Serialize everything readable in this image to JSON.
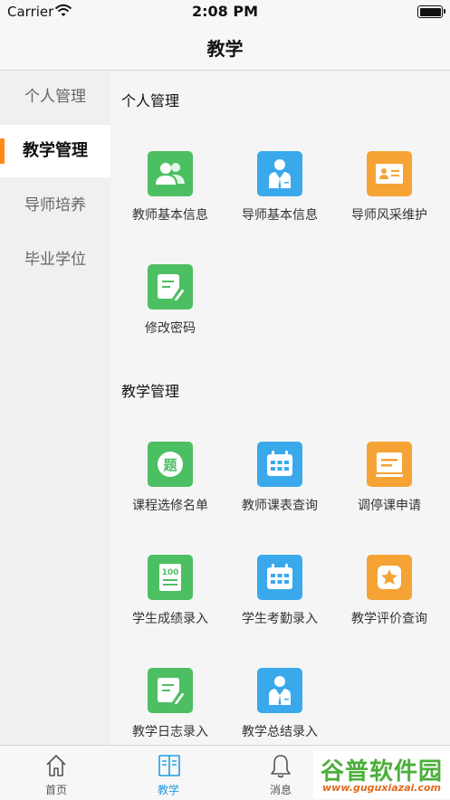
{
  "status": {
    "carrier": "Carrier",
    "time": "2:08 PM"
  },
  "nav": {
    "title": "教学"
  },
  "sidebar": {
    "items": [
      {
        "label": "个人管理",
        "active": false
      },
      {
        "label": "教学管理",
        "active": true
      },
      {
        "label": "导师培养",
        "active": false
      },
      {
        "label": "毕业学位",
        "active": false
      }
    ]
  },
  "sections": [
    {
      "title": "个人管理",
      "items": [
        {
          "label": "教师基本信息",
          "icon": "user-group-icon",
          "color": "#4cbf62"
        },
        {
          "label": "导师基本信息",
          "icon": "mentor-icon",
          "color": "#3aa9ec"
        },
        {
          "label": "导师风采维护",
          "icon": "id-card-icon",
          "color": "#f5a335"
        },
        {
          "label": "修改密码",
          "icon": "edit-document-icon",
          "color": "#4cbf62"
        }
      ]
    },
    {
      "title": "教学管理",
      "items": [
        {
          "label": "课程选修名单",
          "icon": "question-badge-icon",
          "color": "#4cbf62"
        },
        {
          "label": "教师课表查询",
          "icon": "calendar-icon",
          "color": "#3aa9ec"
        },
        {
          "label": "调停课申请",
          "icon": "board-icon",
          "color": "#f5a335"
        },
        {
          "label": "学生成绩录入",
          "icon": "score-sheet-icon",
          "color": "#4cbf62"
        },
        {
          "label": "学生考勤录入",
          "icon": "calendar-icon",
          "color": "#3aa9ec"
        },
        {
          "label": "教学评价查询",
          "icon": "star-icon",
          "color": "#f5a335"
        },
        {
          "label": "教学日志录入",
          "icon": "edit-document-icon",
          "color": "#4cbf62"
        },
        {
          "label": "教学总结录入",
          "icon": "mentor-icon",
          "color": "#3aa9ec"
        }
      ]
    }
  ],
  "tabs": [
    {
      "label": "首页",
      "icon": "home-icon",
      "active": false
    },
    {
      "label": "教学",
      "icon": "book-icon",
      "active": true
    },
    {
      "label": "消息",
      "icon": "bell-icon",
      "active": false
    }
  ],
  "watermark": {
    "main": "谷普软件园",
    "sub": "www.guguxiazai.com"
  },
  "colors": {
    "accent": "#ff8a1a",
    "tab_active": "#1e9be0"
  }
}
